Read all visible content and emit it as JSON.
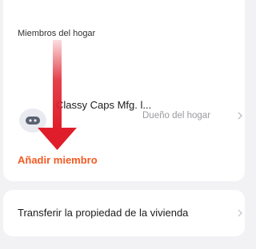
{
  "members_section": {
    "title": "Miembros del hogar",
    "members": [
      {
        "name": "Classy Caps Mfg. l...",
        "role": "Dueño del hogar",
        "avatar_icon": "robot-icon"
      }
    ],
    "add_member_label": "Añadir miembro"
  },
  "transfer_section": {
    "label": "Transferir la propiedad de la vivienda"
  },
  "colors": {
    "background": "#f2f2f4",
    "card": "#ffffff",
    "accent": "#f25a22",
    "annotation_arrow": "#e01e2b",
    "secondary_text": "#9a9a9f"
  }
}
